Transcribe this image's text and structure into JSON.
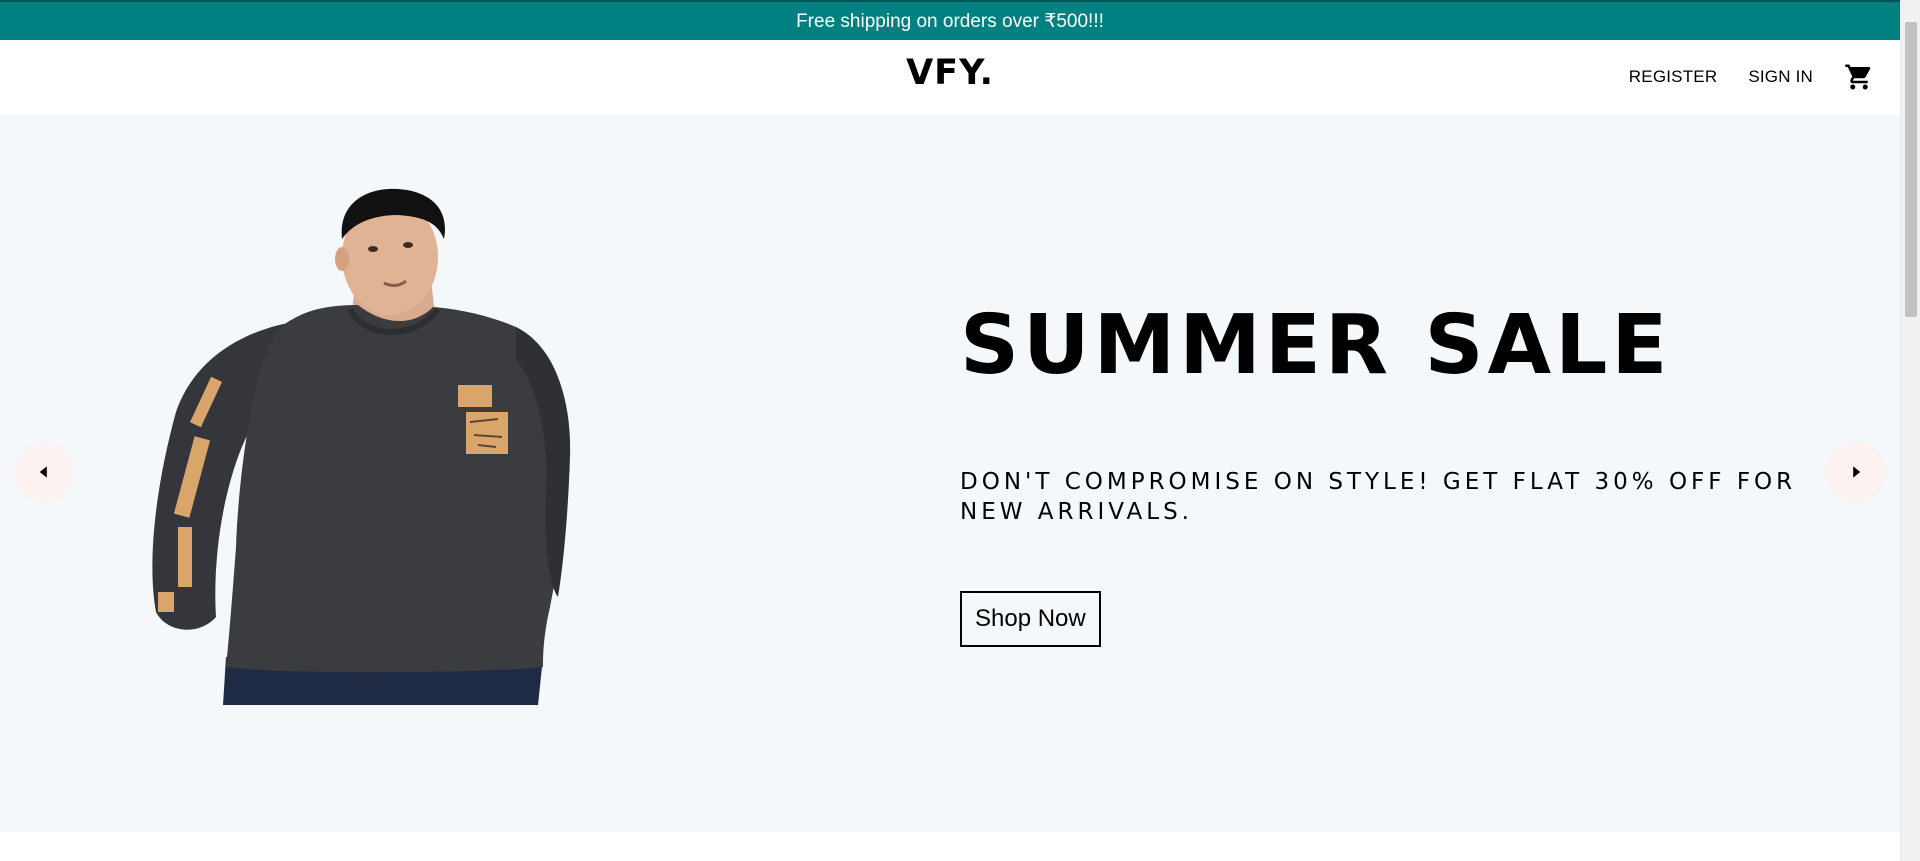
{
  "announcement": {
    "text": "Free shipping on orders over ₹500!!!"
  },
  "header": {
    "logo": "VFY.",
    "register_label": "REGISTER",
    "signin_label": "SIGN IN",
    "cart_icon": "shopping-cart-icon"
  },
  "hero": {
    "title": "SUMMER SALE",
    "description": "DON'T COMPROMISE ON STYLE! GET FLAT 30% OFF FOR NEW ARRIVALS.",
    "button_label": "Shop Now",
    "background": "#f4f8fb",
    "prev_icon": "arrow-left-icon",
    "next_icon": "arrow-right-icon"
  },
  "colors": {
    "announcement_bg": "#008080",
    "shirt": "#3b3c40",
    "print": "#d9a56b",
    "jeans": "#1f2b44"
  }
}
